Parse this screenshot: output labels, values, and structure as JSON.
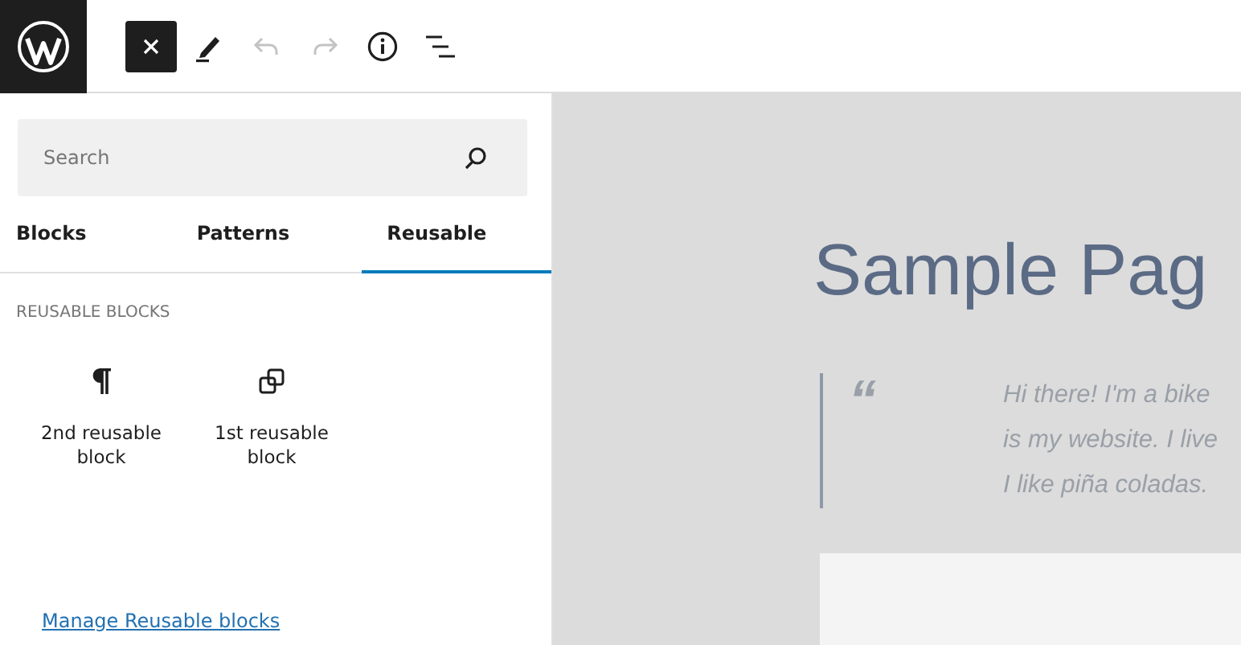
{
  "toolbar": {
    "items": [
      {
        "kind": "close",
        "selected": true,
        "disabled": false
      },
      {
        "kind": "pen",
        "selected": false,
        "disabled": false
      },
      {
        "kind": "undo",
        "selected": false,
        "disabled": true
      },
      {
        "kind": "redo",
        "selected": false,
        "disabled": true
      },
      {
        "kind": "info",
        "selected": false,
        "disabled": false
      },
      {
        "kind": "list",
        "selected": false,
        "disabled": false
      }
    ]
  },
  "sidebar": {
    "search": {
      "placeholder": "Search"
    },
    "tabs": [
      {
        "label": "Blocks",
        "selected": false
      },
      {
        "label": "Patterns",
        "selected": false
      },
      {
        "label": "Reusable",
        "selected": true
      }
    ],
    "section_heading": "REUSABLE BLOCKS",
    "blocks": [
      {
        "kind": "paragraph",
        "label": "2nd reusable block"
      },
      {
        "kind": "reusable",
        "label": "1st reusable block"
      }
    ],
    "manage_link": "Manage Reusable blocks"
  },
  "canvas": {
    "title": "Sample Pag",
    "quote_mark": "“",
    "quote_lines": [
      "Hi there! I'm a bike",
      "is my website. I live",
      "I like piña coladas."
    ]
  }
}
